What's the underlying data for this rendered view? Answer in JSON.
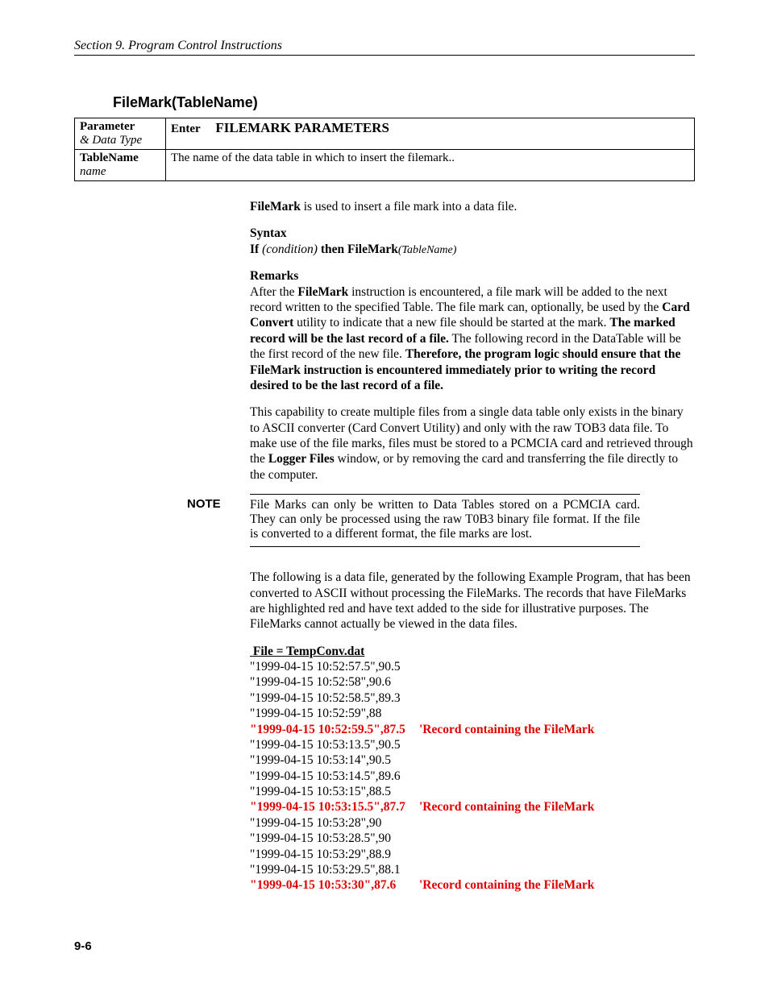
{
  "header": {
    "running": "Section 9.  Program Control Instructions"
  },
  "section": {
    "title": "FileMark(TableName)"
  },
  "table": {
    "hdr_param": "Parameter",
    "hdr_param2": "& Data Type",
    "hdr_enter": "Enter",
    "hdr_title": "FILEMARK PARAMETERS",
    "row_param": "TableName",
    "row_type": "name",
    "row_desc": "The name of the data table in which to insert the filemark.."
  },
  "p_intro_b": "FileMark",
  "p_intro_rest": " is used to insert a file mark into a data file.",
  "syntax_label": "Syntax",
  "syntax_if": "If  ",
  "syntax_cond": "(condition)",
  "syntax_then": " then FileMark",
  "syntax_arg": "(TableName)",
  "remarks_label": "Remarks",
  "remarks_p1_a": "After the ",
  "remarks_p1_b": "FileMark",
  "remarks_p1_c": " instruction is encountered, a file mark will be added to the next record written to the specified Table.  The file mark can, optionally, be used by the ",
  "remarks_p1_d": "Card Convert",
  "remarks_p1_e": " utility to indicate that a new file should be started at the mark.  ",
  "remarks_p1_f": "The marked record will be the last record of a file.",
  "remarks_p1_g": "  The following record in the DataTable will be the first record of the new file.  ",
  "remarks_p1_h": "Therefore, the program logic should ensure that the FileMark instruction is encountered immediately prior to writing the record desired to be the last record of a file.",
  "remarks_p2_a": "This capability to create multiple files from a single data table only exists in the binary to ASCII converter (Card Convert Utility) and only with the raw TOB3 data file.  To make use of the file marks, files must be stored to a PCMCIA card and retrieved through the ",
  "remarks_p2_b": "Logger Files",
  "remarks_p2_c": " window, or by removing the card and transferring the file directly to the computer.",
  "note_label": "NOTE",
  "note_body": "File Marks can only be written to Data Tables stored on a PCMCIA card.  They can only be processed using the raw T0B3 binary file format.  If the file is converted to a different format, the file marks are lost.",
  "post_note": "The following is a data file, generated by the following Example Program, that has been converted to ASCII without processing the FileMarks.  The records that have FileMarks are highlighted red and have text added to the side for illustrative purposes.  The FileMarks cannot actually be viewed in the data files.",
  "file_heading": "File = TempConv.dat",
  "file_note": "'Record containing the FileMark",
  "rows": [
    {
      "t": "\"1999-04-15 10:52:57.5\",90.5",
      "mark": false
    },
    {
      "t": "\"1999-04-15 10:52:58\",90.6",
      "mark": false
    },
    {
      "t": "\"1999-04-15 10:52:58.5\",89.3",
      "mark": false
    },
    {
      "t": "\"1999-04-15 10:52:59\",88",
      "mark": false
    },
    {
      "t": "\"1999-04-15 10:52:59.5\",87.5",
      "mark": true
    },
    {
      "t": "\"1999-04-15 10:53:13.5\",90.5",
      "mark": false
    },
    {
      "t": "\"1999-04-15 10:53:14\",90.5",
      "mark": false
    },
    {
      "t": "\"1999-04-15 10:53:14.5\",89.6",
      "mark": false
    },
    {
      "t": "\"1999-04-15 10:53:15\",88.5",
      "mark": false
    },
    {
      "t": "\"1999-04-15 10:53:15.5\",87.7",
      "mark": true
    },
    {
      "t": "\"1999-04-15 10:53:28\",90",
      "mark": false
    },
    {
      "t": "\"1999-04-15 10:53:28.5\",90",
      "mark": false
    },
    {
      "t": "\"1999-04-15 10:53:29\",88.9",
      "mark": false
    },
    {
      "t": "\"1999-04-15 10:53:29.5\",88.1",
      "mark": false
    },
    {
      "t": "\"1999-04-15 10:53:30\",87.6",
      "mark": true
    }
  ],
  "page_num": "9-6"
}
